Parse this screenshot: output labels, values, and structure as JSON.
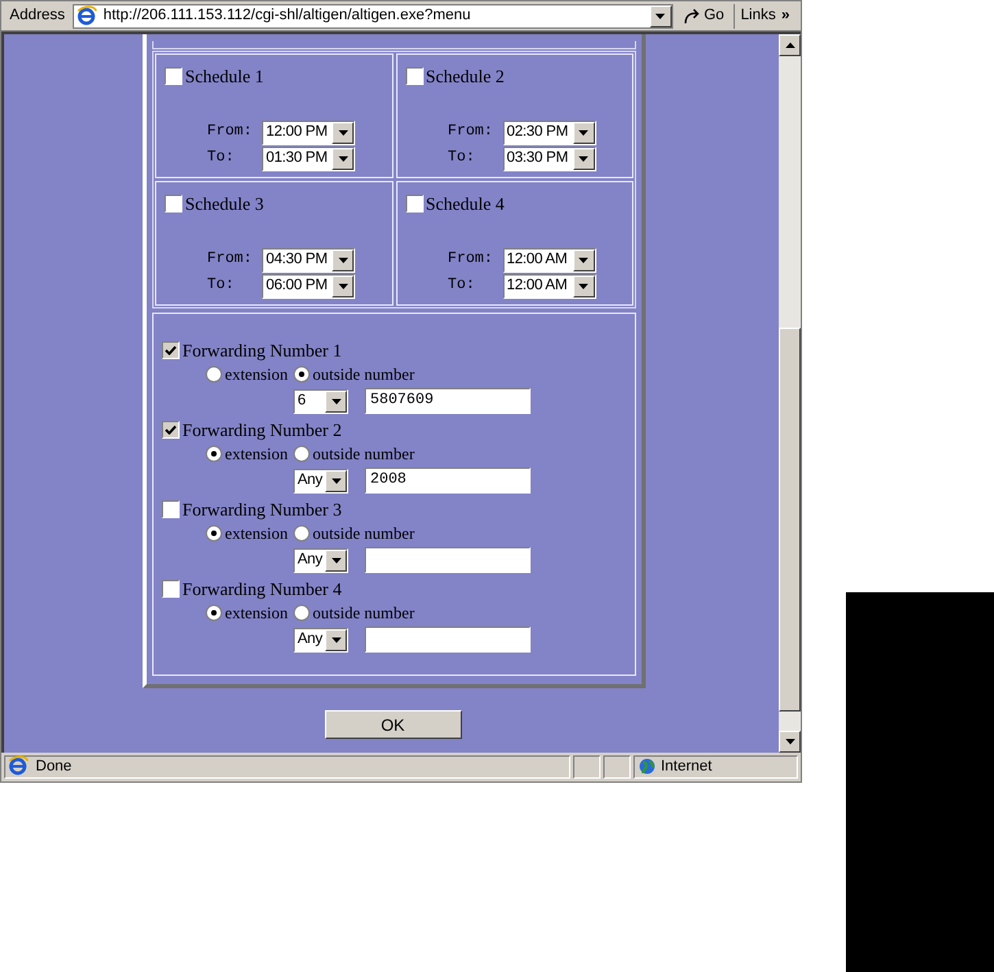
{
  "address_bar": {
    "label": "Address",
    "url": "http://206.111.153.112/cgi-shl/altigen/altigen.exe?menu",
    "go": "Go",
    "links": "Links",
    "links_chevron": "»"
  },
  "schedules": [
    {
      "label": "Schedule 1",
      "checked": false,
      "from_label": "From:",
      "from": "12:00 PM",
      "to_label": "To:",
      "to": "01:30 PM"
    },
    {
      "label": "Schedule 2",
      "checked": false,
      "from_label": "From:",
      "from": "02:30 PM",
      "to_label": "To:",
      "to": "03:30 PM"
    },
    {
      "label": "Schedule 3",
      "checked": false,
      "from_label": "From:",
      "from": "04:30 PM",
      "to_label": "To:",
      "to": "06:00 PM"
    },
    {
      "label": "Schedule 4",
      "checked": false,
      "from_label": "From:",
      "from": "12:00 AM",
      "to_label": "To:",
      "to": "12:00 AM"
    }
  ],
  "forwarding": [
    {
      "label": "Forwarding Number 1",
      "checked": true,
      "options": [
        {
          "label": "extension",
          "selected": false
        },
        {
          "label": "outside number",
          "selected": true
        }
      ],
      "prefix": "6",
      "number": "5807609"
    },
    {
      "label": "Forwarding Number 2",
      "checked": true,
      "options": [
        {
          "label": "extension",
          "selected": true
        },
        {
          "label": "outside number",
          "selected": false
        }
      ],
      "prefix": "Any",
      "number": "2008"
    },
    {
      "label": "Forwarding Number 3",
      "checked": false,
      "options": [
        {
          "label": "extension",
          "selected": true
        },
        {
          "label": "outside number",
          "selected": false
        }
      ],
      "prefix": "Any"
    },
    {
      "label": "Forwarding Number 4",
      "checked": false,
      "options": [
        {
          "label": "extension",
          "selected": true
        },
        {
          "label": "outside number",
          "selected": false
        }
      ],
      "prefix": "Any"
    }
  ],
  "ok_button": "OK",
  "status_bar": {
    "text": "Done",
    "zone": "Internet"
  }
}
